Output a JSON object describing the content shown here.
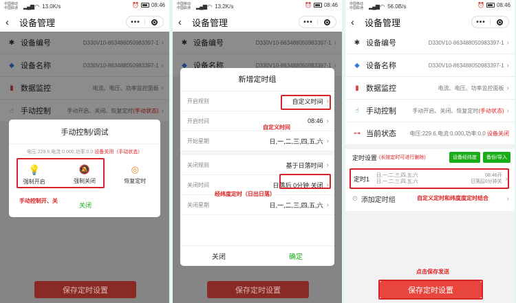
{
  "screens": [
    {
      "status": {
        "carrier1": "中国移动",
        "carrier2": "中国联通",
        "speed": "13.0K/s",
        "time": "08:46"
      },
      "title": "设备管理"
    },
    {
      "status": {
        "carrier1": "中国移动",
        "carrier2": "中国联通",
        "speed": "13.2K/s",
        "time": "08:46"
      },
      "title": "设备管理"
    },
    {
      "status": {
        "carrier1": "中国移动",
        "carrier2": "中国联通",
        "speed": "56.0B/s",
        "time": "08:46"
      },
      "title": "设备管理"
    }
  ],
  "device_rows": {
    "number": {
      "label": "设备编号",
      "value": "D330V10-863488050983397-1"
    },
    "name": {
      "label": "设备名称",
      "value": "D330V10-863488050983397-1"
    },
    "monitor": {
      "label": "数据监控",
      "value": "电流、电压、功率监控面板"
    },
    "manual": {
      "label": "手动控制",
      "value": "手动开启、关闭、恢复定时",
      "value_note": "(手动状态)"
    },
    "state": {
      "label": "当前状态",
      "value": "电压:229.6,电流:0.000,功率:0.0",
      "value_note": "设备关闭"
    }
  },
  "manual_dialog": {
    "title": "手动控制/调试",
    "info": "电压:229.6,电流:0.000,功率:0.0",
    "info_status": "设备关闭（手动状态）",
    "force_on": "强制开启",
    "force_off": "强制关闭",
    "restore": "恢复定时",
    "close": "关闭",
    "annotation": "手动控制开、关"
  },
  "timer_dialog": {
    "title": "新增定时组",
    "rows": [
      {
        "label": "开启规则",
        "value": "自定义时间"
      },
      {
        "label": "开启时间",
        "value": "08:46"
      },
      {
        "label": "开始星期",
        "value": "日,一,二,三,四,五,六"
      },
      {
        "label": "关闭规则",
        "value": "基于日落时间"
      },
      {
        "label": "关闭时间",
        "value": "日落后  0分钟  关闭"
      },
      {
        "label": "关闭星期",
        "value": "日,一,二,三,四,五,六"
      }
    ],
    "annot_custom": "自定义时间",
    "annot_sunset": "经纬度定时（日出日落）",
    "close": "关闭",
    "confirm": "确定"
  },
  "timer_settings": {
    "label": "定时设置",
    "hint": "(长按定时可进行删除)",
    "btn_latlng": "设备经纬度",
    "btn_backup": "备份/导入",
    "timer": {
      "name": "定时1",
      "days1": "日,一,二,三,四,五,六",
      "days2": "日,一,二,三,四,五,六",
      "time1": "08:46开",
      "time2": "日落后0分钟关"
    },
    "add": "添加定时组",
    "annot_combined": "自定义定时和纬度度定时结合",
    "annot_save": "点击保存发送"
  },
  "save_button": "保存定时设置",
  "colors": {
    "accent_red": "#e02020",
    "save_red": "#e8453c",
    "save_dim": "#8a2a24",
    "green": "#1aad19",
    "frame": "#d8222a"
  }
}
